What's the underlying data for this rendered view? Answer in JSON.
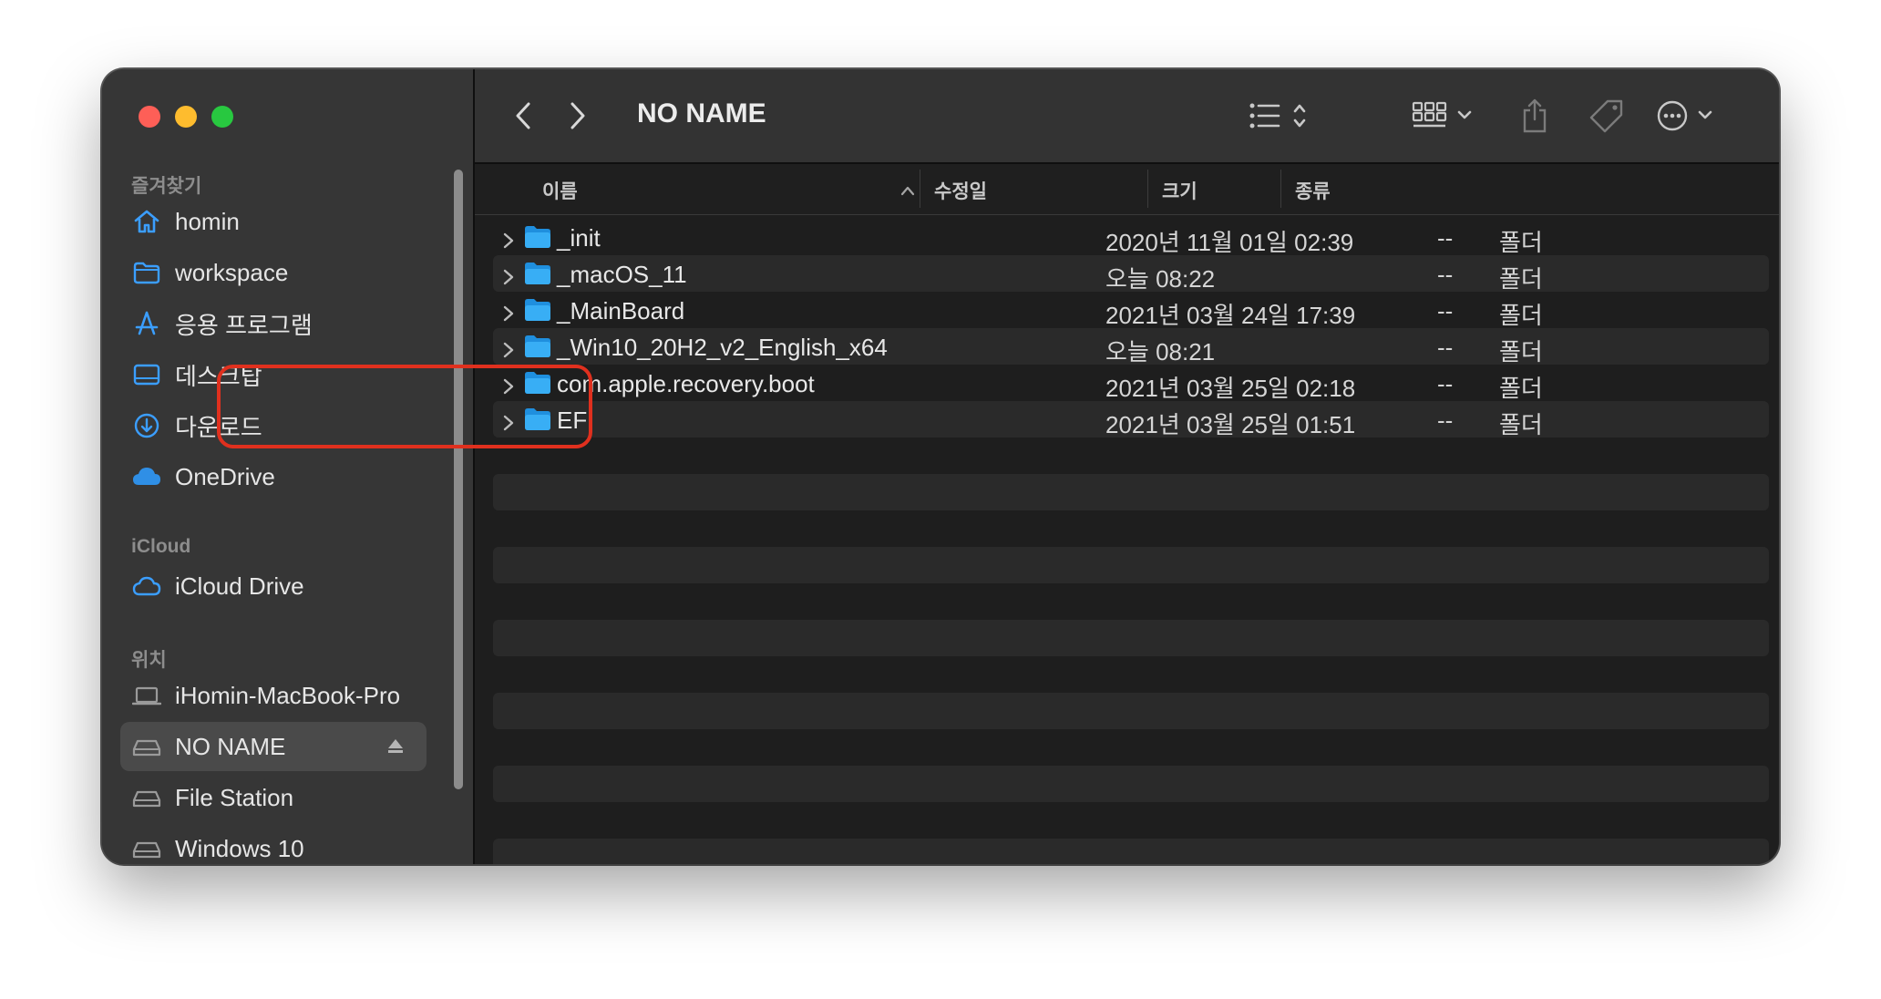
{
  "window": {
    "title": "NO NAME"
  },
  "sidebar": {
    "favorites_title": "즐겨찾기",
    "favorites": [
      {
        "label": "homin",
        "icon": "house-icon"
      },
      {
        "label": "workspace",
        "icon": "folder-icon"
      },
      {
        "label": "응용 프로그램",
        "icon": "applications-icon"
      },
      {
        "label": "데스크탑",
        "icon": "desktop-icon"
      },
      {
        "label": "다운로드",
        "icon": "download-icon"
      },
      {
        "label": "OneDrive",
        "icon": "onedrive-cloud-icon"
      }
    ],
    "icloud_title": "iCloud",
    "icloud": [
      {
        "label": "iCloud Drive",
        "icon": "icloud-icon"
      }
    ],
    "locations_title": "위치",
    "locations": [
      {
        "label": "iHomin-MacBook-Pro",
        "icon": "laptop-icon"
      },
      {
        "label": "NO NAME",
        "icon": "drive-icon",
        "selected": true,
        "eject": true
      },
      {
        "label": "File Station",
        "icon": "drive-icon"
      },
      {
        "label": "Windows 10",
        "icon": "drive-icon"
      }
    ]
  },
  "toolbar": {
    "back_icon": "chevron-left-icon",
    "forward_icon": "chevron-right-icon",
    "view_icon": "list-view-icon",
    "group_icon": "group-grid-icon",
    "share_icon": "share-icon",
    "tag_icon": "tag-icon",
    "more_icon": "ellipsis-circle-icon",
    "search_icon": "search-icon"
  },
  "columns": {
    "name": "이름",
    "modified": "수정일",
    "size": "크기",
    "kind": "종류"
  },
  "files": [
    {
      "name": "_init",
      "modified": "2020년 11월 01일 02:39",
      "size": "--",
      "kind": "폴더"
    },
    {
      "name": "_macOS_11",
      "modified": "오늘 08:22",
      "size": "--",
      "kind": "폴더"
    },
    {
      "name": "_MainBoard",
      "modified": "2021년 03월 24일 17:39",
      "size": "--",
      "kind": "폴더"
    },
    {
      "name": "_Win10_20H2_v2_English_x64",
      "modified": "오늘 08:21",
      "size": "--",
      "kind": "폴더"
    },
    {
      "name": "com.apple.recovery.boot",
      "modified": "2021년 03월 25일 02:18",
      "size": "--",
      "kind": "폴더"
    },
    {
      "name": "EFI",
      "modified": "2021년 03월 25일 01:51",
      "size": "--",
      "kind": "폴더"
    }
  ],
  "colors": {
    "highlight_box": "#e0301e",
    "folder_blue": "#2ea3f2",
    "accent_blue": "#3b9eff"
  }
}
